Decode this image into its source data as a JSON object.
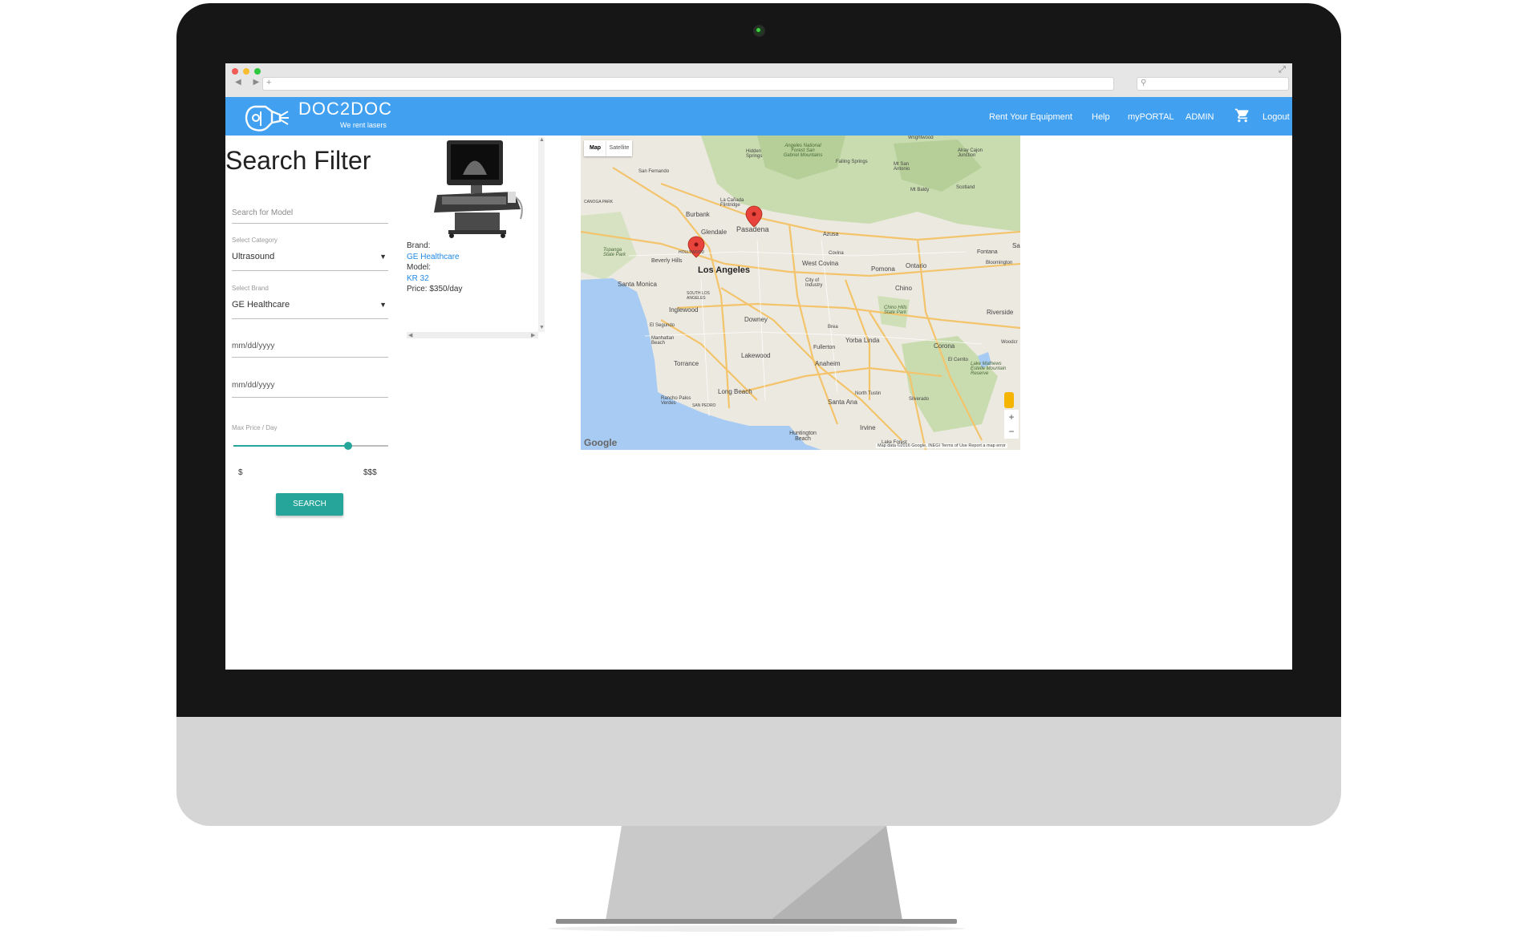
{
  "app": {
    "brand": "DOC2DOC",
    "tagline": "We rent lasers",
    "nav": [
      "Rent Your Equipment",
      "Help",
      "myPORTAL",
      "ADMIN",
      "Logout"
    ]
  },
  "filter": {
    "title": "Search Filter",
    "search_placeholder": "Search for Model",
    "category_label": "Select Category",
    "category_value": "Ultrasound",
    "brand_label": "Select Brand",
    "brand_value": "GE Healthcare",
    "start_date_placeholder": "mm/dd/yyyy",
    "end_date_placeholder": "mm/dd/yyyy",
    "price_label": "Max Price / Day",
    "price_min_label": "$",
    "price_max_label": "$$$",
    "price_slider_fraction": 0.74,
    "search_button": "SEARCH"
  },
  "result": {
    "brand_label": "Brand:",
    "brand_value": "GE Healthcare",
    "model_label": "Model:",
    "model_value": "KR 32",
    "price": "Price: $350/day"
  },
  "map": {
    "map_tab": "Map",
    "satellite_tab": "Satellite",
    "zoom_in": "+",
    "zoom_out": "−",
    "google_logo": "Google",
    "attribution": "Map data ©2016 Google, INEGI   Terms of Use   Report a map error",
    "cities": {
      "los_angeles": "Los Angeles",
      "pasadena": "Pasadena",
      "glendale": "Glendale",
      "burbank": "Burbank",
      "santa_monica": "Santa Monica",
      "beverly_hills": "Beverly Hills",
      "inglewood": "Inglewood",
      "torrance": "Torrance",
      "long_beach": "Long Beach",
      "downey": "Downey",
      "lakewood": "Lakewood",
      "anaheim": "Anaheim",
      "fullerton": "Fullerton",
      "santa_ana": "Santa Ana",
      "irvine": "Irvine",
      "huntington_beach": "Huntington Beach",
      "west_covina": "West Covina",
      "pomona": "Pomona",
      "ontario": "Ontario",
      "chino": "Chino",
      "riverside": "Riverside",
      "corona": "Corona",
      "fontana": "Fontana",
      "yorba_linda": "Yorba Linda",
      "azusa": "Azusa",
      "covina": "Covina",
      "brea": "Brea",
      "el_segundo": "El Segundo",
      "manhattan_beach": "Manhattan Beach",
      "rancho_palos_verdes": "Rancho Palos Verdes",
      "san_fernando": "San Fernando",
      "la_canada": "La Cañada Flintridge",
      "hidden_springs": "Hidden Springs",
      "angeles_forest": "Angeles National Forest San Gabriel Mountains",
      "falling_springs": "Falling Springs",
      "wrightwood": "Wrightwood",
      "scotland": "Scotland",
      "mt_baldy": "Mt Baldy",
      "san_antonio": "Mt San Antonio",
      "alray": "Alray Cajon Junction",
      "topanga": "Topanga State Park",
      "canoga_park": "CANOGA PARK",
      "chino_hills": "Chino Hills State Park",
      "lake_mathews": "Lake Mathews Estelle Mountain Reserve",
      "el_cerrito": "El Cerrito",
      "silverado": "Silverado",
      "north_tustin": "North Tustin",
      "city_of_industry": "City of Industry",
      "bloomington": "Bloomington",
      "woodcrest": "Woodcr",
      "san_pedro": "SAN PEDRO",
      "sa": "Sa",
      "lake_forest": "Lake Forest",
      "hollywood": "HOLLYWOOD",
      "south_la": "SOUTH LOS ANGELES"
    }
  }
}
